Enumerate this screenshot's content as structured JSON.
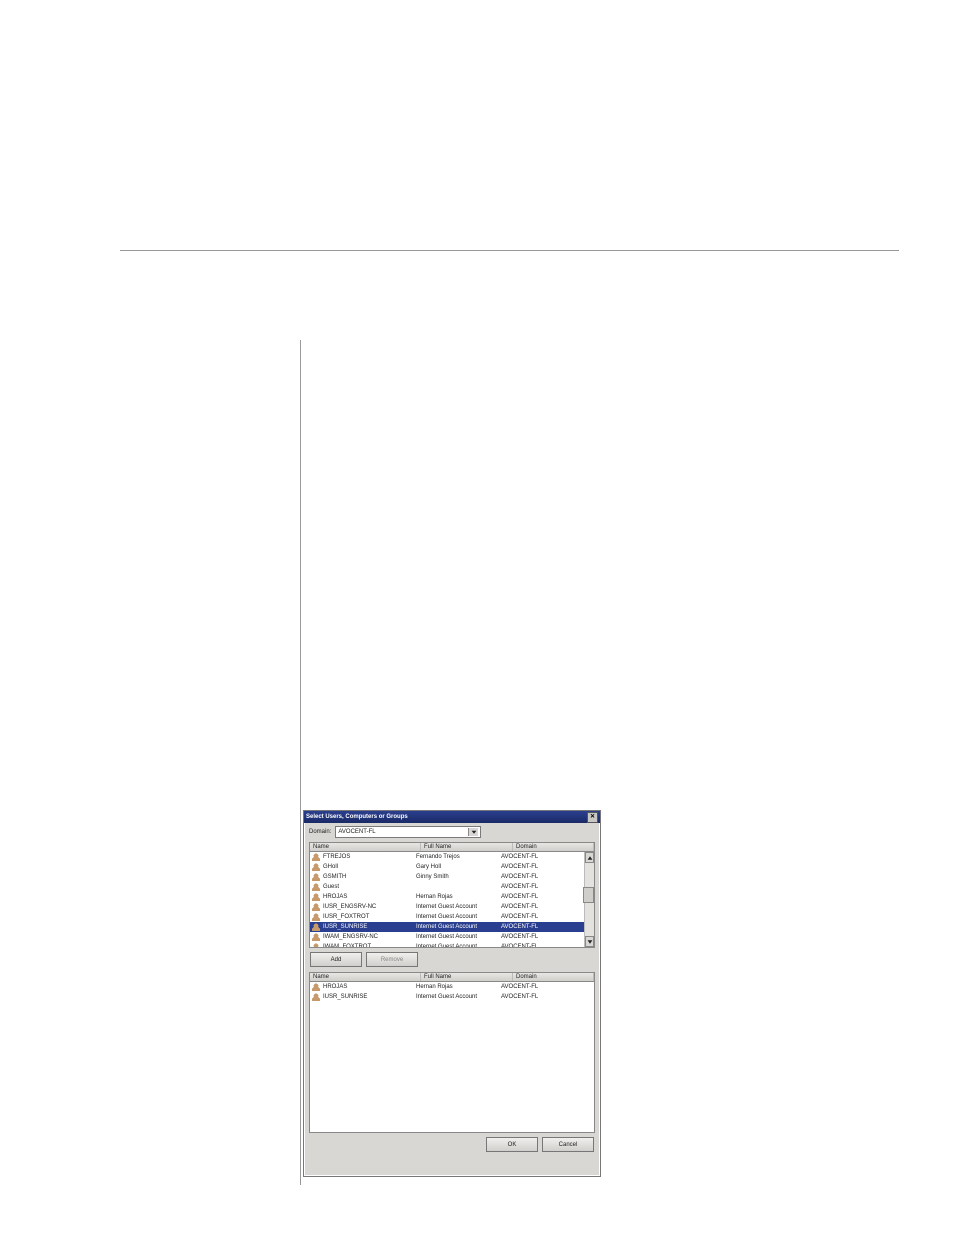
{
  "dialog": {
    "title": "Select Users, Computers or Groups",
    "domain_label": "Domain:",
    "domain_value": "AVOCENT-FL",
    "columns": {
      "name": "Name",
      "full": "Full Name",
      "domain": "Domain"
    },
    "available": [
      {
        "name": "FTREJOS",
        "full": "Fernando Trejos",
        "domain": "AVOCENT-FL",
        "selected": false
      },
      {
        "name": "GHoll",
        "full": "Gary Holl",
        "domain": "AVOCENT-FL",
        "selected": false
      },
      {
        "name": "GSMITH",
        "full": "Ginny Smith",
        "domain": "AVOCENT-FL",
        "selected": false
      },
      {
        "name": "Guest",
        "full": "",
        "domain": "AVOCENT-FL",
        "selected": false
      },
      {
        "name": "HROJAS",
        "full": "Hernan Rojas",
        "domain": "AVOCENT-FL",
        "selected": false
      },
      {
        "name": "IUSR_ENGSRV-NC",
        "full": "Internet Guest Account",
        "domain": "AVOCENT-FL",
        "selected": false
      },
      {
        "name": "IUSR_FOXTROT",
        "full": "Internet Guest Account",
        "domain": "AVOCENT-FL",
        "selected": false
      },
      {
        "name": "IUSR_SUNRISE",
        "full": "Internet Guest Account",
        "domain": "AVOCENT-FL",
        "selected": true
      },
      {
        "name": "IWAM_ENGSRV-NC",
        "full": "Internet Guest Account",
        "domain": "AVOCENT-FL",
        "selected": false
      },
      {
        "name": "IWAM_FOXTROT",
        "full": "Internet Guest Account",
        "domain": "AVOCENT-FL",
        "selected": false
      }
    ],
    "buttons": {
      "add": "Add",
      "remove": "Remove",
      "ok": "OK",
      "cancel": "Cancel"
    },
    "selected_list": [
      {
        "name": "HROJAS",
        "full": "Hernan Rojas",
        "domain": "AVOCENT-FL"
      },
      {
        "name": "IUSR_SUNRISE",
        "full": "Internet Guest Account",
        "domain": "AVOCENT-FL"
      }
    ]
  }
}
